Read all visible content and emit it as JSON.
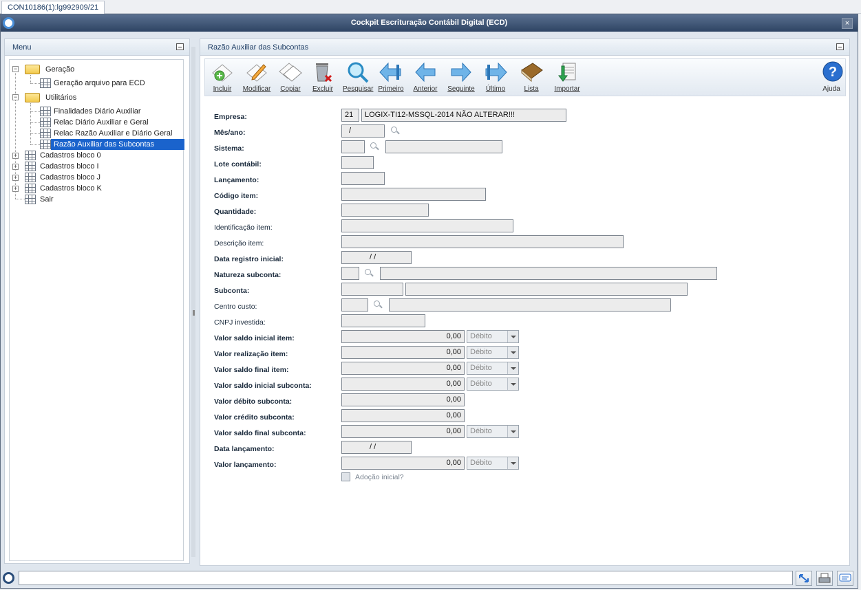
{
  "tab": {
    "label": "CON10186(1):lg992909/21"
  },
  "window": {
    "title": "Cockpit Escrituração Contábil Digital (ECD)"
  },
  "menu": {
    "title": "Menu",
    "tree": [
      {
        "label": "Geração",
        "type": "folder"
      },
      {
        "label": "Geração arquivo para ECD",
        "type": "item"
      },
      {
        "label": "Utilitários",
        "type": "folder"
      },
      {
        "label": "Finalidades Diário Auxiliar",
        "type": "item"
      },
      {
        "label": "Relac Diário Auxiliar e Geral",
        "type": "item"
      },
      {
        "label": "Relac Razão Auxiliar e Diário Geral",
        "type": "item"
      },
      {
        "label": "Razão Auxiliar das Subcontas",
        "type": "item",
        "selected": true
      },
      {
        "label": "Cadastros bloco 0",
        "type": "group"
      },
      {
        "label": "Cadastros bloco I",
        "type": "group"
      },
      {
        "label": "Cadastros bloco J",
        "type": "group"
      },
      {
        "label": "Cadastros bloco K",
        "type": "group"
      },
      {
        "label": "Sair",
        "type": "item"
      }
    ]
  },
  "main": {
    "title": "Razão Auxiliar das Subcontas",
    "toolbar": {
      "incluir": "Incluir",
      "modificar": "Modificar",
      "copiar": "Copiar",
      "excluir": "Excluir",
      "pesquisar": "Pesquisar",
      "primeiro": "Primeiro",
      "anterior": "Anterior",
      "seguinte": "Seguinte",
      "ultimo": "Último",
      "lista": "Lista",
      "importar": "Importar",
      "ajuda": "Ajuda"
    },
    "form": {
      "empresa": {
        "label": "Empresa:",
        "code": "21",
        "name": "LOGIX-TI12-MSSQL-2014 NÃO ALTERAR!!!"
      },
      "mes_ano": {
        "label": "Mês/ano:",
        "value": "/"
      },
      "sistema": {
        "label": "Sistema:"
      },
      "lote": {
        "label": "Lote contábil:"
      },
      "lancamento": {
        "label": "Lançamento:"
      },
      "codigo_item": {
        "label": "Código item:"
      },
      "quantidade": {
        "label": "Quantidade:"
      },
      "ident_item": {
        "label": "Identificação item:"
      },
      "desc_item": {
        "label": "Descrição item:"
      },
      "data_registro": {
        "label": "Data registro inicial:",
        "value": "/ /"
      },
      "natureza": {
        "label": "Natureza subconta:"
      },
      "subconta": {
        "label": "Subconta:"
      },
      "centro_custo": {
        "label": "Centro custo:"
      },
      "cnpj": {
        "label": "CNPJ investida:"
      },
      "saldo_ini_item": {
        "label": "Valor saldo inicial item:",
        "value": "0,00",
        "option": "Débito"
      },
      "realizacao_item": {
        "label": "Valor realização item:",
        "value": "0,00",
        "option": "Débito"
      },
      "saldo_fin_item": {
        "label": "Valor saldo final item:",
        "value": "0,00",
        "option": "Débito"
      },
      "saldo_ini_sub": {
        "label": "Valor saldo inicial subconta:",
        "value": "0,00",
        "option": "Débito"
      },
      "debito_sub": {
        "label": "Valor débito subconta:",
        "value": "0,00"
      },
      "credito_sub": {
        "label": "Valor crédito subconta:",
        "value": "0,00"
      },
      "saldo_fin_sub": {
        "label": "Valor saldo final subconta:",
        "value": "0,00",
        "option": "Débito"
      },
      "data_lanc": {
        "label": "Data lançamento:",
        "value": "/ /"
      },
      "valor_lanc": {
        "label": "Valor lançamento:",
        "value": "0,00",
        "option": "Débito"
      },
      "adocao": {
        "label": "Adoção inicial?"
      }
    }
  },
  "colors": {
    "titlebar": "#2e4463",
    "selection": "#1a63cc",
    "accent": "#4a8fd8"
  }
}
